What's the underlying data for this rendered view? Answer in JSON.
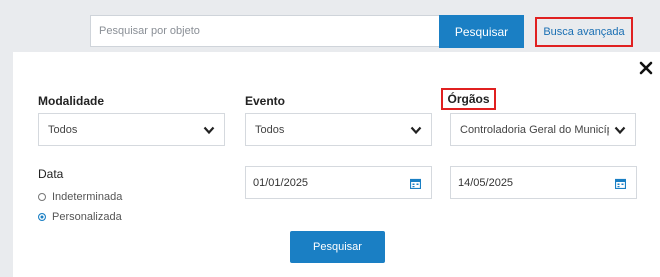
{
  "topbar": {
    "search_placeholder": "Pesquisar por objeto",
    "search_button": "Pesquisar",
    "advanced_link": "Busca avançada"
  },
  "filters": {
    "modalidade": {
      "label": "Modalidade",
      "value": "Todos"
    },
    "evento": {
      "label": "Evento",
      "value": "Todos"
    },
    "orgaos": {
      "label": "Órgãos",
      "value": "Controladoria Geral do Município"
    },
    "data": {
      "label": "Data",
      "options": [
        "Indeterminada",
        "Personalizada"
      ],
      "selected": "Personalizada",
      "start": "01/01/2025",
      "end": "14/05/2025"
    }
  },
  "submit_label": "Pesquisar",
  "colors": {
    "primary": "#1a7fc4",
    "highlight": "#e02020",
    "link": "#1a6fb3"
  },
  "icons": [
    "close-icon",
    "chevron-down-icon",
    "calendar-icon"
  ]
}
